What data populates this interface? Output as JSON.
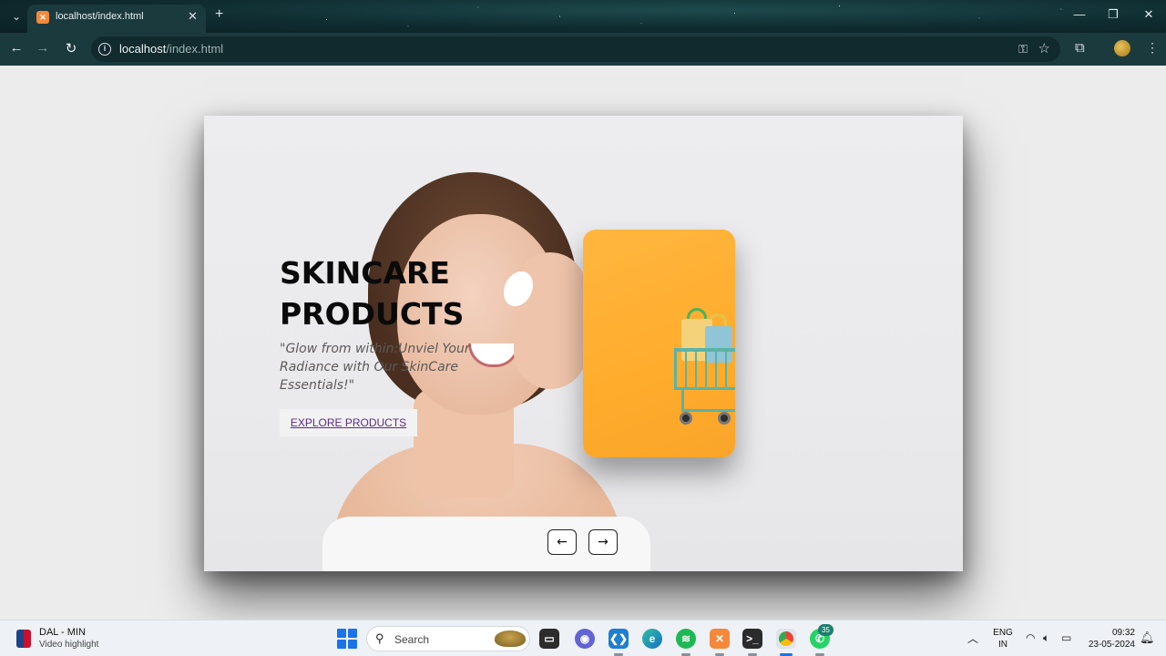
{
  "browser": {
    "tab_title": "localhost/index.html",
    "tab_close": "✕",
    "new_tab": "+",
    "url_host": "localhost",
    "url_path": "/index.html",
    "window_controls": {
      "minimize": "—",
      "maximize": "❐",
      "close": "✕"
    },
    "nav": {
      "back": "←",
      "forward": "→",
      "reload": "↻"
    },
    "icons": [
      "info-icon",
      "key-icon",
      "star-icon",
      "extensions-icon",
      "profile-icon",
      "menu-icon"
    ]
  },
  "hero": {
    "headline_line1": "SKINCARE",
    "headline_line2": "PRODUCTS",
    "tagline": "\"Glow from within:Unviel Your Radiance with Our SkinCare Essentials!\"",
    "cta_label": "EXPLORE PRODUCTS",
    "prev_label": "←",
    "next_label": "→"
  },
  "colors": {
    "card_accent": "#ffb63f",
    "cta_text": "#5a2d8a",
    "cart": "#5bb3a6"
  },
  "taskbar": {
    "news_title": "DAL - MIN",
    "news_sub": "Video highlight",
    "search_label": "Search",
    "whatsapp_badge": "35",
    "lang_line1": "ENG",
    "lang_line2": "IN",
    "time": "09:32",
    "date": "23-05-2024",
    "apps": [
      "files",
      "teams",
      "vscode",
      "edge",
      "spotify",
      "xampp",
      "terminal",
      "chrome",
      "whatsapp"
    ]
  }
}
